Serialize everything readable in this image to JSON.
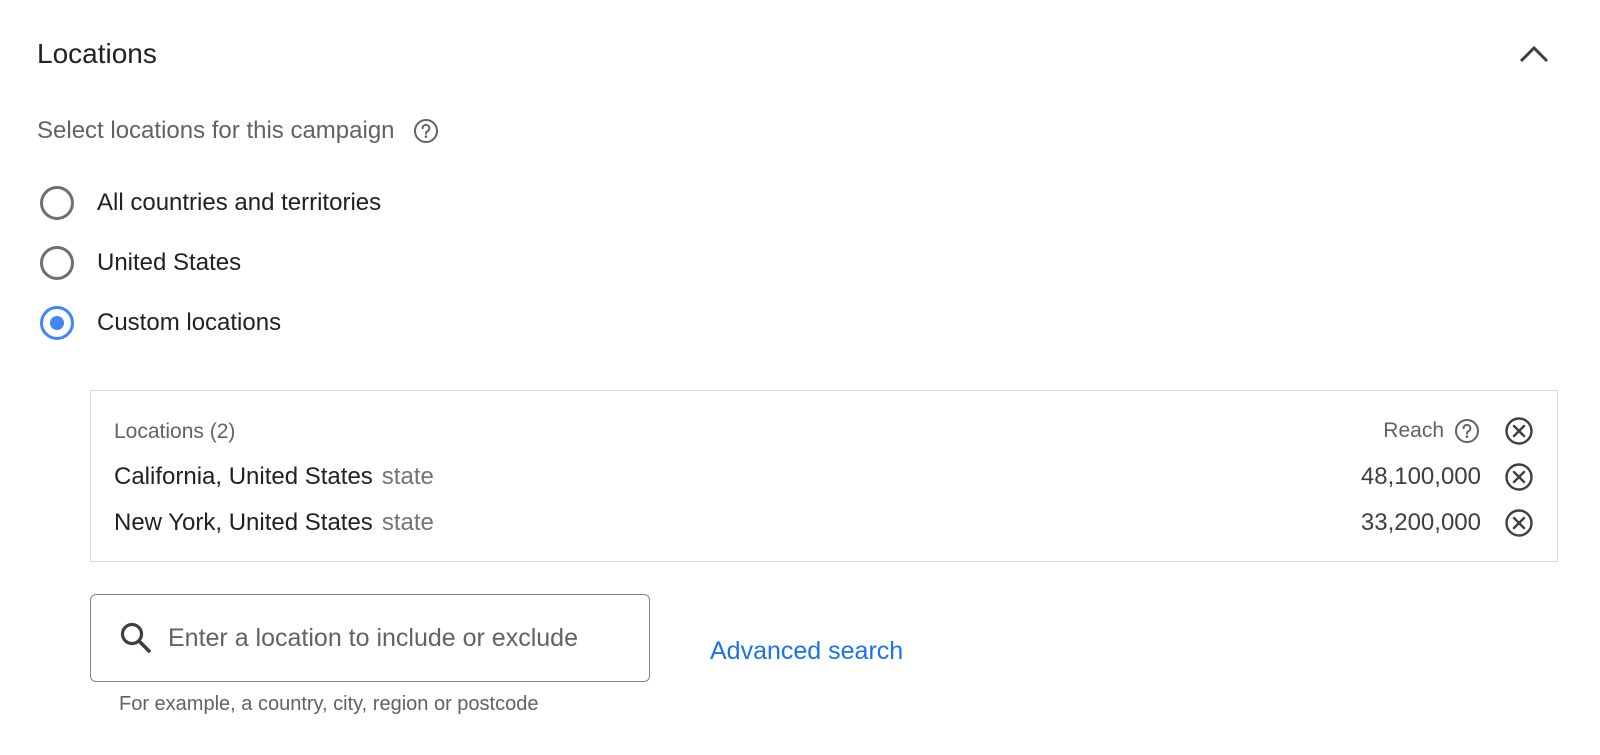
{
  "section": {
    "title": "Locations"
  },
  "select": {
    "heading": "Select locations for this campaign"
  },
  "options": [
    {
      "label": "All countries and territories",
      "checked": false
    },
    {
      "label": "United States",
      "checked": false
    },
    {
      "label": "Custom locations",
      "checked": true
    }
  ],
  "targeted": {
    "header": "Locations (2)",
    "reach_label": "Reach",
    "rows": [
      {
        "name": "California, United States",
        "type": "state",
        "reach": "48,100,000"
      },
      {
        "name": "New York, United States",
        "type": "state",
        "reach": "33,200,000"
      }
    ]
  },
  "search": {
    "placeholder": "Enter a location to include or exclude",
    "value": "",
    "advanced_label": "Advanced search",
    "hint": "For example, a country, city, region or postcode"
  },
  "colors": {
    "accent": "#4285f4",
    "link": "#1a73e8",
    "text": "#202124",
    "secondary_text": "#5f6368",
    "border": "#dadce0"
  },
  "icons": {
    "collapse": "chevron-up-icon",
    "help": "help-circle-icon",
    "remove": "cancel-circle-icon",
    "search": "search-icon"
  }
}
